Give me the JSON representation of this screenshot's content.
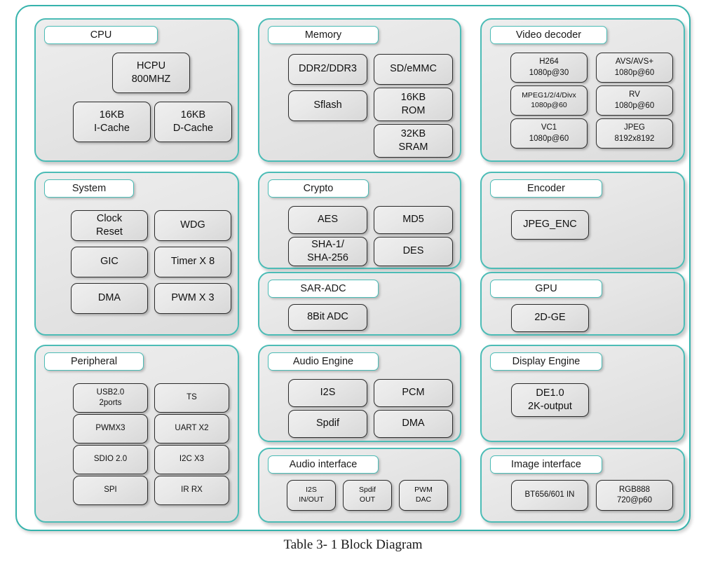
{
  "caption": "Table 3- 1 Block Diagram",
  "colors": {
    "accent_teal": "#4cbcb6",
    "frame_teal": "#35b3ac",
    "panel_bg": "#e6e6e6",
    "block_bg": "#e8e8e8",
    "block_border": "#2b2b2b",
    "page_bg": "#ffffff"
  },
  "panels": {
    "cpu": {
      "title": "CPU",
      "blocks": [
        {
          "l1": "HCPU",
          "l2": "800MHZ"
        },
        {
          "l1": "16KB",
          "l2": "I-Cache"
        },
        {
          "l1": "16KB",
          "l2": "D-Cache"
        }
      ]
    },
    "system": {
      "title": "System",
      "blocks": [
        {
          "l1": "Clock",
          "l2": "Reset"
        },
        {
          "l1": "WDG",
          "l2": ""
        },
        {
          "l1": "GIC",
          "l2": ""
        },
        {
          "l1": "Timer X 8",
          "l2": ""
        },
        {
          "l1": "DMA",
          "l2": ""
        },
        {
          "l1": "PWM X 3",
          "l2": ""
        }
      ]
    },
    "peripheral": {
      "title": "Peripheral",
      "blocks": [
        {
          "l1": "USB2.0",
          "l2": "2ports"
        },
        {
          "l1": "TS",
          "l2": ""
        },
        {
          "l1": "PWMX3",
          "l2": ""
        },
        {
          "l1": "UART X2",
          "l2": ""
        },
        {
          "l1": "SDIO 2.0",
          "l2": ""
        },
        {
          "l1": "I2C X3",
          "l2": ""
        },
        {
          "l1": "SPI",
          "l2": ""
        },
        {
          "l1": "IR RX",
          "l2": ""
        }
      ]
    },
    "memory": {
      "title": "Memory",
      "blocks": [
        {
          "l1": "DDR2/DDR3",
          "l2": ""
        },
        {
          "l1": "SD/eMMC",
          "l2": ""
        },
        {
          "l1": "Sflash",
          "l2": ""
        },
        {
          "l1": "16KB",
          "l2": "ROM"
        },
        {
          "l1": "32KB",
          "l2": "SRAM"
        }
      ]
    },
    "crypto": {
      "title": "Crypto",
      "blocks": [
        {
          "l1": "AES",
          "l2": ""
        },
        {
          "l1": "MD5",
          "l2": ""
        },
        {
          "l1": "SHA-1/",
          "l2": "SHA-256"
        },
        {
          "l1": "DES",
          "l2": ""
        }
      ]
    },
    "sar_adc": {
      "title": "SAR-ADC",
      "blocks": [
        {
          "l1": "8Bit ADC",
          "l2": ""
        }
      ]
    },
    "audio_engine": {
      "title": "Audio Engine",
      "blocks": [
        {
          "l1": "I2S",
          "l2": ""
        },
        {
          "l1": "PCM",
          "l2": ""
        },
        {
          "l1": "Spdif",
          "l2": ""
        },
        {
          "l1": "DMA",
          "l2": ""
        }
      ]
    },
    "audio_interface": {
      "title": "Audio interface",
      "blocks": [
        {
          "l1": "I2S",
          "l2": "IN/OUT"
        },
        {
          "l1": "Spdif",
          "l2": "OUT"
        },
        {
          "l1": "PWM",
          "l2": "DAC"
        }
      ]
    },
    "video_decoder": {
      "title": "Video decoder",
      "blocks": [
        {
          "l1": "H264",
          "l2": "1080p@30"
        },
        {
          "l1": "AVS/AVS+",
          "l2": "1080p@60"
        },
        {
          "l1": "MPEG1/2/4/Divx",
          "l2": "1080p@60"
        },
        {
          "l1": "RV",
          "l2": "1080p@60"
        },
        {
          "l1": "VC1",
          "l2": "1080p@60"
        },
        {
          "l1": "JPEG",
          "l2": "8192x8192"
        }
      ]
    },
    "encoder": {
      "title": "Encoder",
      "blocks": [
        {
          "l1": "JPEG_ENC",
          "l2": ""
        }
      ]
    },
    "gpu": {
      "title": "GPU",
      "blocks": [
        {
          "l1": "2D-GE",
          "l2": ""
        }
      ]
    },
    "display_engine": {
      "title": "Display Engine",
      "blocks": [
        {
          "l1": "DE1.0",
          "l2": "2K-output"
        }
      ]
    },
    "image_interface": {
      "title": "Image interface",
      "blocks": [
        {
          "l1": "BT656/601 IN",
          "l2": ""
        },
        {
          "l1": "RGB888",
          "l2": "720@p60"
        }
      ]
    }
  }
}
